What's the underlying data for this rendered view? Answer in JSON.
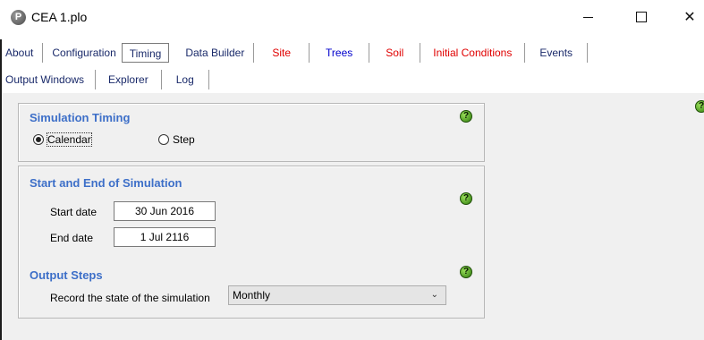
{
  "window": {
    "title": "CEA 1.plo",
    "app_icon_letter": "P"
  },
  "tabs_row1": [
    {
      "label": "About",
      "color": "dark"
    },
    {
      "label": "Configuration",
      "color": "dark"
    },
    {
      "label": "Timing",
      "color": "dark",
      "active": true
    },
    {
      "label": "Data Builder",
      "color": "dark"
    },
    {
      "label": "Site",
      "color": "red"
    },
    {
      "label": "Trees",
      "color": "blue"
    },
    {
      "label": "Soil",
      "color": "red"
    },
    {
      "label": "Initial Conditions",
      "color": "red"
    },
    {
      "label": "Events",
      "color": "dark"
    }
  ],
  "tabs_row2": [
    {
      "label": "Output Windows"
    },
    {
      "label": "Explorer"
    },
    {
      "label": "Log"
    }
  ],
  "timing": {
    "simulation_timing": {
      "heading": "Simulation Timing",
      "calendar_label": "Calendar",
      "step_label": "Step",
      "selected": "Calendar"
    },
    "start_end": {
      "heading": "Start and End of Simulation",
      "start_label": "Start date",
      "start_value": "30 Jun 2016",
      "end_label": "End date",
      "end_value": "1 Jul 2116"
    },
    "output_steps": {
      "heading": "Output Steps",
      "record_label": "Record the state of the simulation",
      "record_value": "Monthly"
    },
    "help_glyph": "?"
  },
  "colors": {
    "heading_blue": "#3d6fc8",
    "tab_red": "#e00000",
    "tab_blue": "#0000cc",
    "panel_bg": "#f0f0f0",
    "help_green": "#5aa02c"
  }
}
